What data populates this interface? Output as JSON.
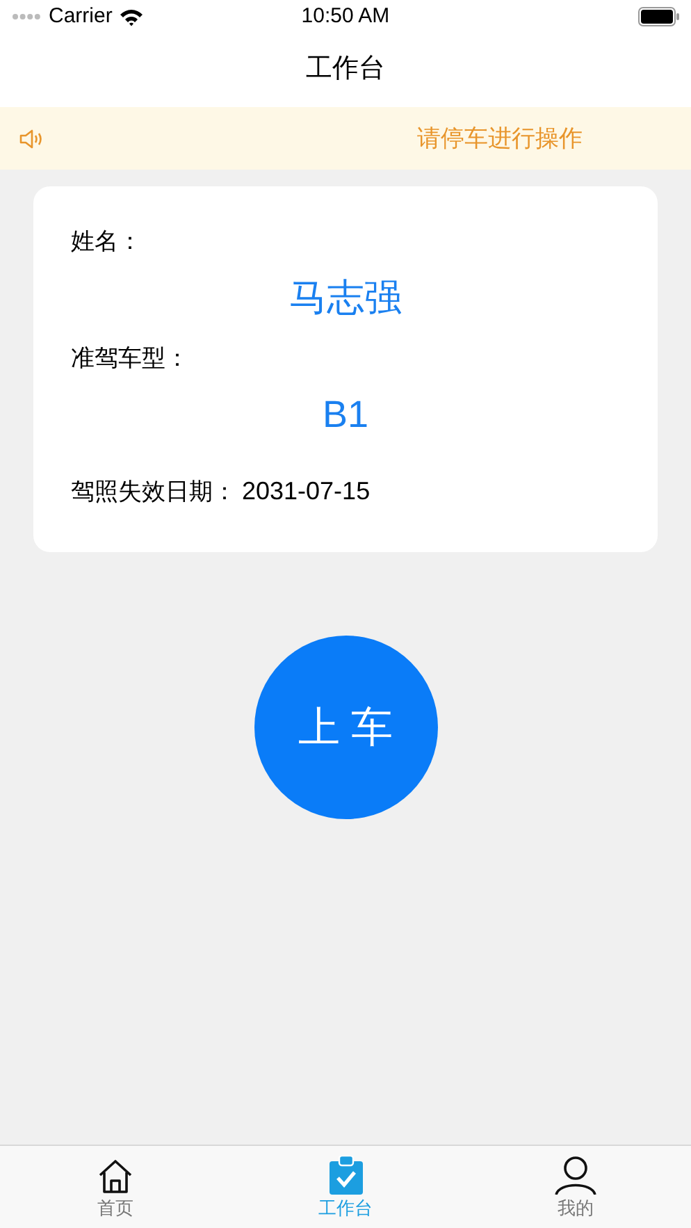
{
  "status_bar": {
    "carrier": "Carrier",
    "time": "10:50 AM"
  },
  "nav": {
    "title": "工作台"
  },
  "notice": {
    "text": "请停车进行操作"
  },
  "card": {
    "fields": [
      {
        "kind": "stacked",
        "label": "姓名：",
        "value": "马志强"
      },
      {
        "kind": "stacked",
        "label": "准驾车型：",
        "value": "B1"
      },
      {
        "kind": "inline",
        "label": "驾照失效日期：",
        "value": "2031-07-15"
      }
    ]
  },
  "action_button": {
    "label": "上 车"
  },
  "tabs": [
    {
      "label": "首页",
      "selected": false
    },
    {
      "label": "工作台",
      "selected": true
    },
    {
      "label": "我的",
      "selected": false
    }
  ]
}
